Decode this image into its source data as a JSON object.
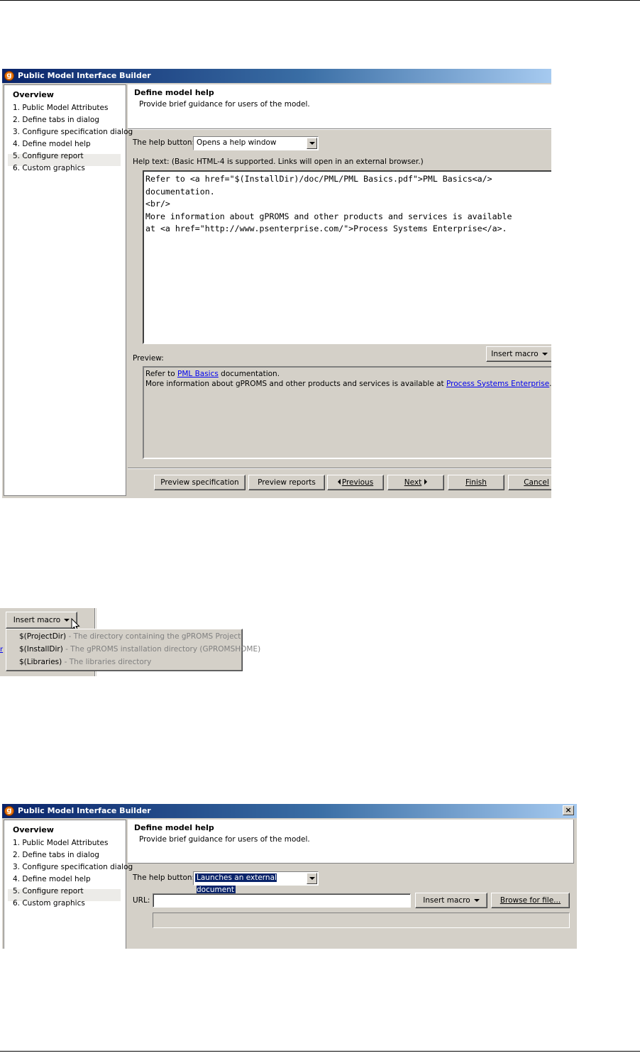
{
  "screenshot1": {
    "window_title": "Public Model Interface Builder",
    "nav": {
      "title": "Overview",
      "items": [
        "1. Public Model Attributes",
        "2. Define tabs in dialog",
        "3. Configure specification dialog",
        "4. Define model help",
        "5. Configure report",
        "6. Custom graphics"
      ],
      "selected_index": 3
    },
    "header": {
      "title": "Define model help",
      "subtitle": "Provide brief guidance for users of the model."
    },
    "help_button_label": "The help button:",
    "help_button_value": "Opens a help window",
    "help_text_label": "Help text: (Basic HTML-4 is supported. Links will open in an external browser.)",
    "help_text_value": "Refer to <a href=\"$(InstallDir)/doc/PML/PML Basics.pdf\">PML Basics<a/>\ndocumentation.\n<br/>\nMore information about gPROMS and other products and services is available\nat <a href=\"http://www.psenterprise.com/\">Process Systems Enterprise</a>.",
    "insert_macro_label": "Insert macro",
    "preview_label": "Preview:",
    "preview": {
      "line1_before": "Refer to ",
      "line1_link": "PML Basics",
      "line1_after": " documentation.",
      "line2_before": "More information about gPROMS and other products and services is available at ",
      "line2_link": "Process Systems Enterprise",
      "line2_after": "."
    },
    "buttons": {
      "preview_spec": "Preview specification",
      "preview_reports": "Preview reports",
      "previous": "Previous",
      "next": "Next",
      "finish": "Finish",
      "cancel": "Cancel"
    }
  },
  "screenshot2": {
    "insert_macro_label": "Insert macro",
    "menu_items": [
      {
        "macro": "$(ProjectDir)",
        "desc": " - The directory containing the gPROMS Project"
      },
      {
        "macro": "$(InstallDir)",
        "desc": " - The gPROMS installation directory (GPROMSHOME)"
      },
      {
        "macro": "$(Libraries)",
        "desc": " - The libraries directory"
      }
    ]
  },
  "screenshot3": {
    "window_title": "Public Model Interface Builder",
    "nav": {
      "title": "Overview",
      "items": [
        "1. Public Model Attributes",
        "2. Define tabs in dialog",
        "3. Configure specification dialog",
        "4. Define model help",
        "5. Configure report",
        "6. Custom graphics"
      ],
      "selected_index": 3
    },
    "header": {
      "title": "Define model help",
      "subtitle": "Provide brief guidance for users of the model."
    },
    "help_button_label": "The help button:",
    "help_button_value": "Launches an external document",
    "url_label": "URL:",
    "url_value": "",
    "insert_macro_label": "Insert macro",
    "browse_label": "Browse for file..."
  },
  "colors": {
    "title_gradient_start": "#0a246a",
    "title_gradient_end": "#a6caf0",
    "dialog_face": "#d4d0c8",
    "link": "#0000ee",
    "selection": "#0a246a"
  }
}
